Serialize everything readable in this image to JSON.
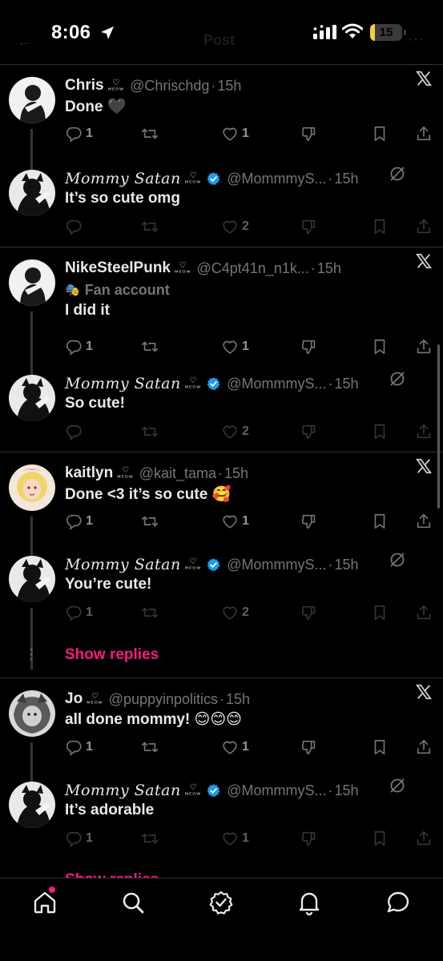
{
  "status_bar": {
    "time": "8:06",
    "battery": "15",
    "battery_level": 0.15
  },
  "ghost_header": {
    "title": "Post"
  },
  "threads": [
    {
      "posts": [
        {
          "display_name": "Chris",
          "badge": "ᴹᴱᴼᵂ",
          "handle": "@Chrischdg",
          "dot": "·",
          "time": "15h",
          "text": "Done 🖤",
          "replies": "1",
          "reposts": "",
          "likes": "1"
        },
        {
          "display_name": "𝑀𝑜𝑚𝑚𝑦 𝑆𝑎𝑡𝑎𝑛",
          "badge": "ᴹᴱᴼᵂ",
          "handle": "@MommmyS...",
          "dot": "·",
          "time": "15h",
          "text": "It’s so cute omg",
          "replies": "",
          "reposts": "",
          "likes": "2"
        }
      ]
    },
    {
      "posts": [
        {
          "display_name": "NikeSteelPunk",
          "badge": "ᴹᴱᴼᵂ",
          "handle": "@C4pt41n_n1k...",
          "dot": "·",
          "time": "15h",
          "subline": "Fan account",
          "text": "I did it",
          "replies": "1",
          "reposts": "",
          "likes": "1"
        },
        {
          "display_name": "𝑀𝑜𝑚𝑚𝑦 𝑆𝑎𝑡𝑎𝑛",
          "badge": "ᴹᴱᴼᵂ",
          "handle": "@MommmyS...",
          "dot": "·",
          "time": "15h",
          "text": "So cute!",
          "replies": "",
          "reposts": "",
          "likes": "2"
        }
      ]
    },
    {
      "posts": [
        {
          "display_name": "kaitlyn",
          "badge": "ᴹᴱᴼᵂ",
          "handle": "@kait_tama",
          "dot": "·",
          "time": "15h",
          "text": "Done <3 it’s so cute 🥰",
          "replies": "1",
          "reposts": "",
          "likes": "1"
        },
        {
          "display_name": "𝑀𝑜𝑚𝑚𝑦 𝑆𝑎𝑡𝑎𝑛",
          "badge": "ᴹᴱᴼᵂ",
          "handle": "@MommmyS...",
          "dot": "·",
          "time": "15h",
          "text": "You’re cute!",
          "replies": "1",
          "reposts": "",
          "likes": "2"
        }
      ],
      "show_replies": "Show replies"
    },
    {
      "posts": [
        {
          "display_name": "Jo",
          "badge": "ᴹᴱᴼᵂ",
          "handle": "@puppyinpolitics",
          "dot": "·",
          "time": "15h",
          "text": "all done mommy! 😊😊😊",
          "replies": "1",
          "reposts": "",
          "likes": "1"
        },
        {
          "display_name": "𝑀𝑜𝑚𝑚𝑦 𝑆𝑎𝑡𝑎𝑛",
          "badge": "ᴹᴱᴼᵂ",
          "handle": "@MommmyS...",
          "dot": "·",
          "time": "15h",
          "text": "It’s adorable",
          "replies": "1",
          "reposts": "",
          "likes": "1"
        }
      ]
    }
  ],
  "footer_peek": "Show replies",
  "tabs": [
    {
      "name": "home",
      "icon": "home-icon"
    },
    {
      "name": "search",
      "icon": "search-icon"
    },
    {
      "name": "communities",
      "icon": "verified-badge-icon"
    },
    {
      "name": "notifications",
      "icon": "bell-icon"
    },
    {
      "name": "messages",
      "icon": "message-bubble-icon"
    }
  ],
  "colors": {
    "accent": "#f91880",
    "verified": "#1d9bf0",
    "muted": "#71767b",
    "battery": "#f2d23a"
  }
}
